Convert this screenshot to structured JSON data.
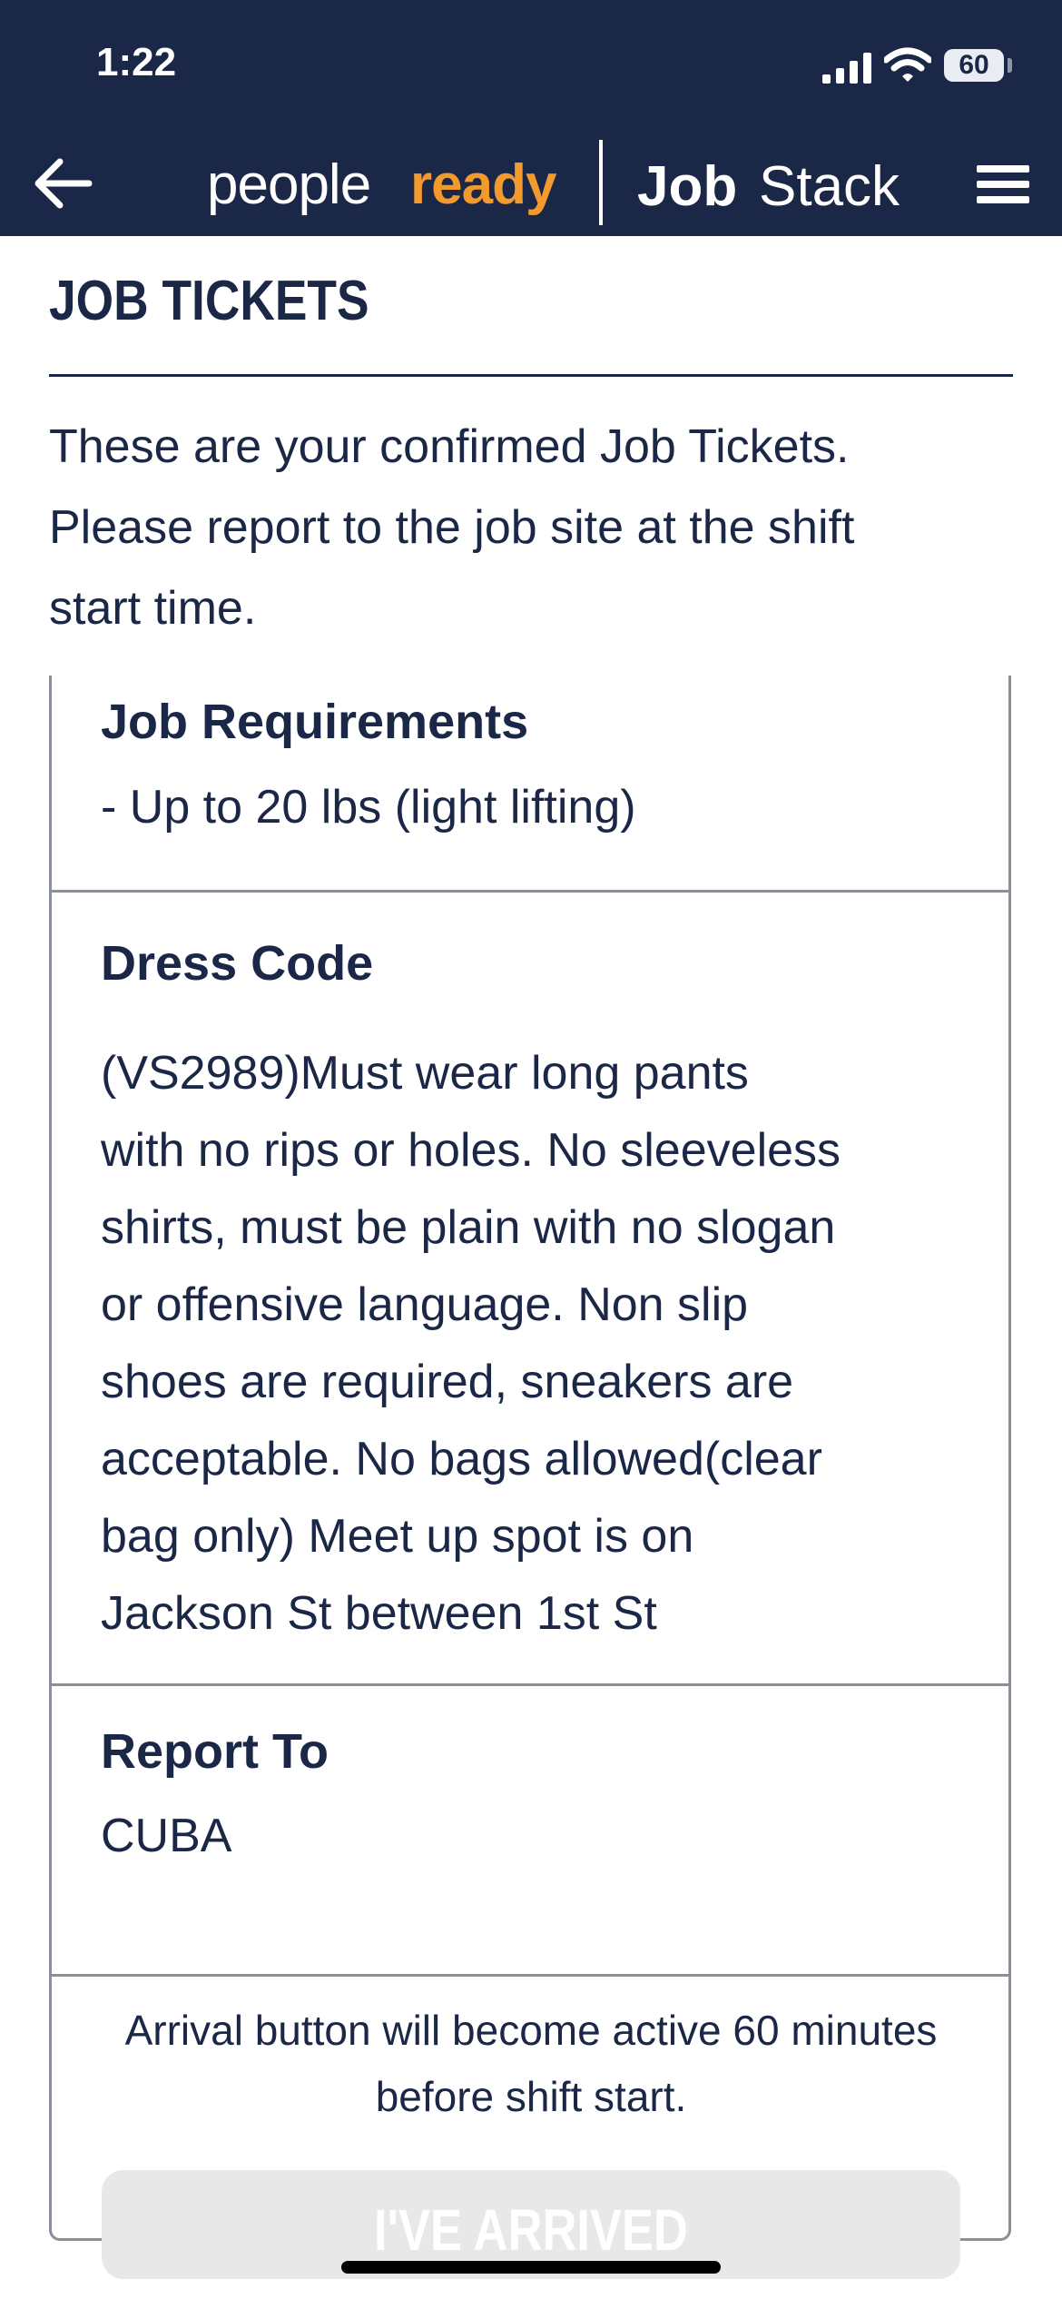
{
  "status_bar": {
    "time": "1:22",
    "battery": "60"
  },
  "header": {
    "logo_people": "people",
    "logo_ready": "ready",
    "logo_job": "Job",
    "logo_stack": "Stack"
  },
  "page": {
    "title": "JOB TICKETS",
    "intro_lines": [
      "These are your confirmed Job Tickets.",
      "Please report to the job site at the shift",
      "start time."
    ]
  },
  "ticket": {
    "job_requirements": {
      "heading": "Job Requirements",
      "value": "- Up to 20 lbs (light lifting)"
    },
    "dress_code": {
      "heading": "Dress Code",
      "lines": [
        "(VS2989)Must wear long pants",
        "with no rips or holes. No sleeveless",
        "shirts, must be plain with no slogan",
        "or offensive language. Non slip",
        "shoes are required, sneakers are",
        "acceptable. No bags allowed(clear",
        "bag only) Meet up spot is on",
        "Jackson St between 1st St"
      ]
    },
    "report_to": {
      "heading": "Report To",
      "value": "CUBA"
    },
    "arrival_note_lines": [
      "Arrival button will become active 60 minutes",
      "before shift start."
    ],
    "arrived_button": "I'VE ARRIVED"
  },
  "colors": {
    "navy": "#1b2746",
    "orange": "#f29a2e",
    "border": "#8a8f99"
  }
}
